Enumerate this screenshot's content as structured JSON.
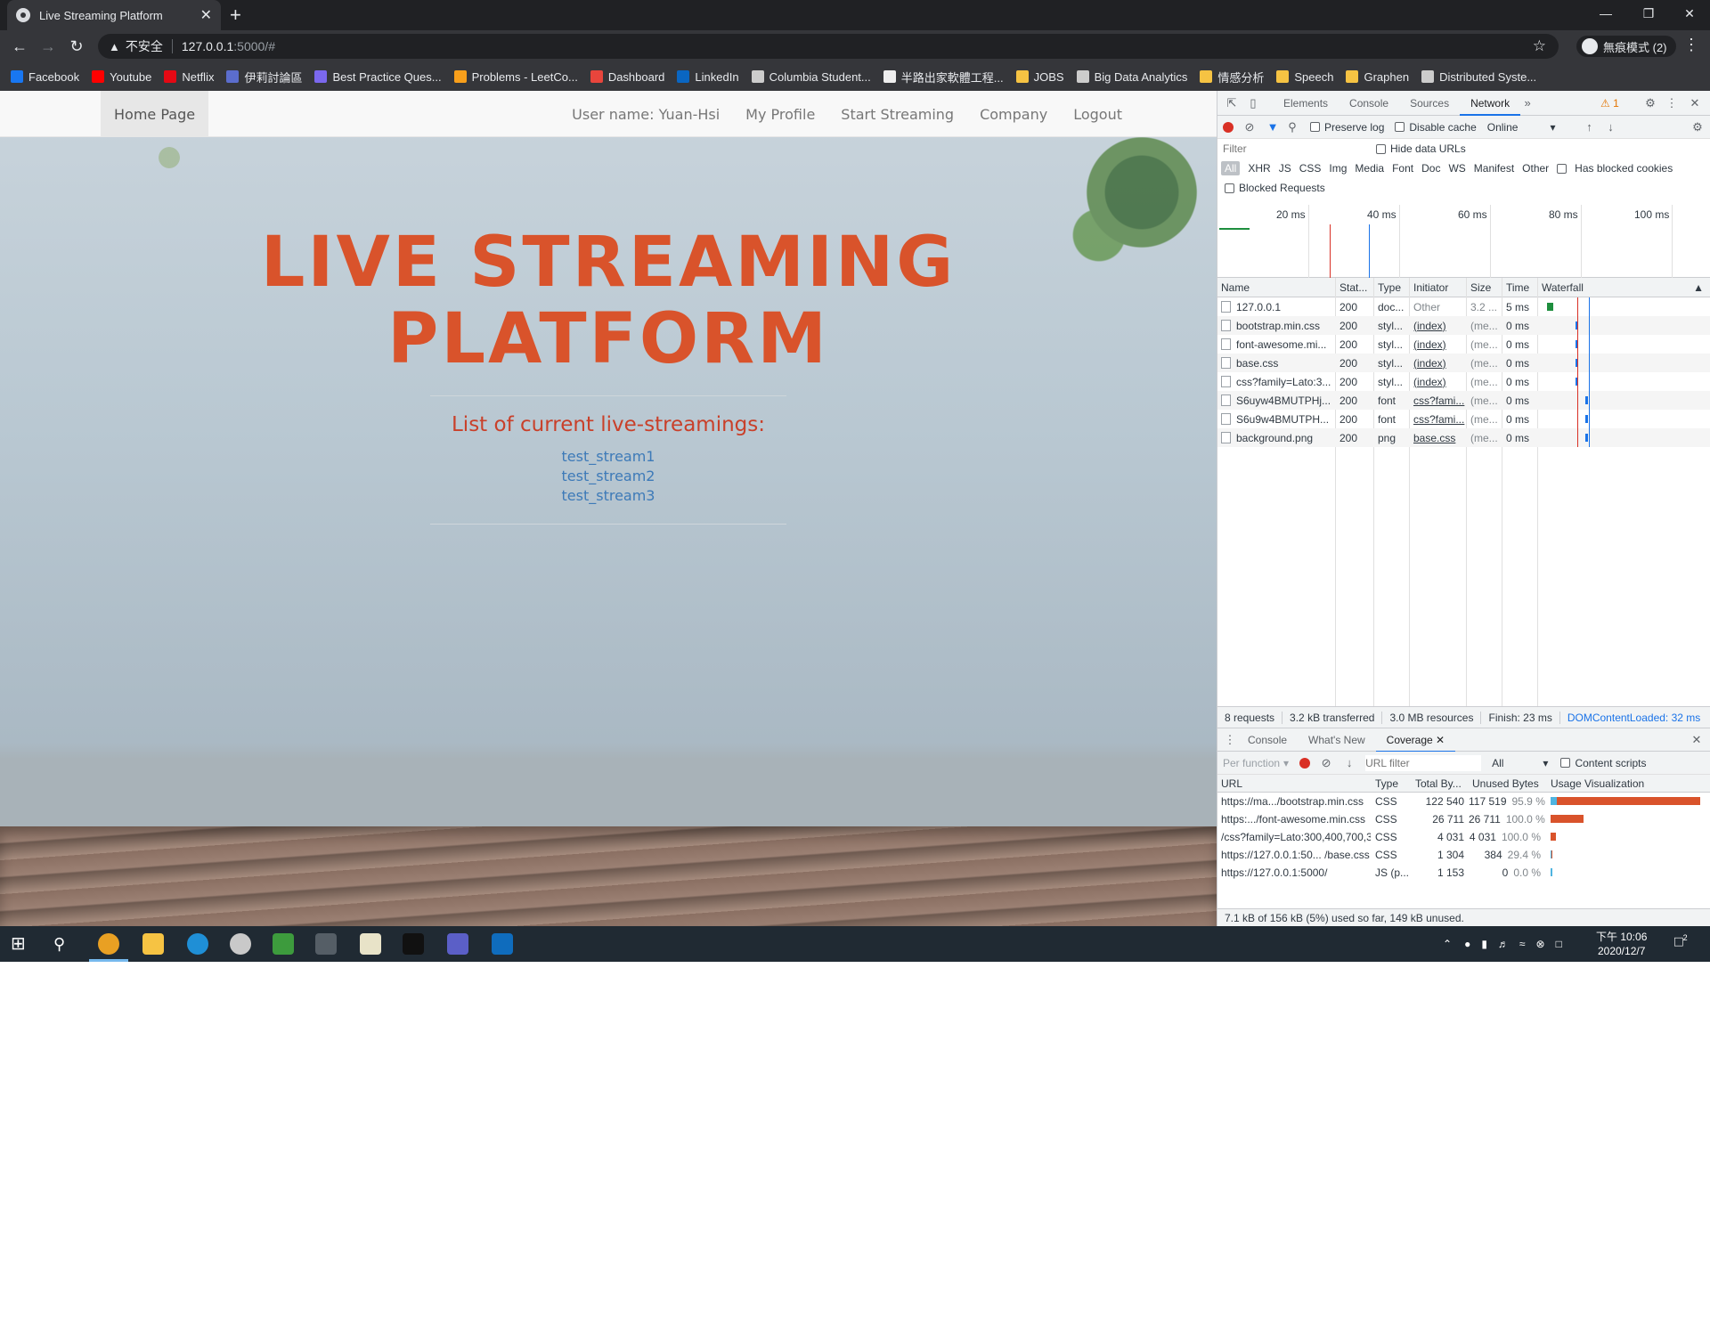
{
  "browser": {
    "tab_title": "Live Streaming Platform",
    "tab_close": "✕",
    "new_tab": "+",
    "url_warning": "不安全",
    "url_host": "127.0.0.1",
    "url_path": ":5000/#",
    "incognito_label": "無痕模式 (2)",
    "bookmarks": [
      {
        "label": "Facebook",
        "color": "#1877f2"
      },
      {
        "label": "Youtube",
        "color": "#ff0000"
      },
      {
        "label": "Netflix",
        "color": "#e50914"
      },
      {
        "label": "伊莉討論區",
        "color": "#5b6dcd"
      },
      {
        "label": "Best Practice Ques...",
        "color": "#7b68ee"
      },
      {
        "label": "Problems - LeetCo...",
        "color": "#f89f1b"
      },
      {
        "label": "Dashboard",
        "color": "#e8453c"
      },
      {
        "label": "LinkedIn",
        "color": "#0a66c2"
      },
      {
        "label": "Columbia Student...",
        "color": "#cccccc"
      },
      {
        "label": "半路出家軟體工程...",
        "color": "#eeeeee"
      },
      {
        "label": "JOBS",
        "color": "#f6c343"
      },
      {
        "label": "Big Data Analytics",
        "color": "#cccccc"
      },
      {
        "label": "情感分析",
        "color": "#f6c343"
      },
      {
        "label": "Speech",
        "color": "#f6c343"
      },
      {
        "label": "Graphen",
        "color": "#f6c343"
      },
      {
        "label": "Distributed Syste...",
        "color": "#cccccc"
      }
    ]
  },
  "page": {
    "nav": {
      "home": "Home Page",
      "username": "User name: Yuan-Hsi",
      "profile": "My Profile",
      "start": "Start Streaming",
      "company": "Company",
      "logout": "Logout"
    },
    "title_line1": "LIVE STREAMING",
    "title_line2": "PLATFORM",
    "subtitle": "List of current live-streamings:",
    "streams": [
      "test_stream1",
      "test_stream2",
      "test_stream3"
    ]
  },
  "devtools": {
    "tabs": [
      "Elements",
      "Console",
      "Sources",
      "Network"
    ],
    "active_tab": "Network",
    "warning_count": "1",
    "preserve_log": "Preserve log",
    "disable_cache": "Disable cache",
    "throttle": "Online",
    "filter_placeholder": "Filter",
    "hide_data_urls": "Hide data URLs",
    "filter_types": [
      "All",
      "XHR",
      "JS",
      "CSS",
      "Img",
      "Media",
      "Font",
      "Doc",
      "WS",
      "Manifest",
      "Other"
    ],
    "has_blocked_cookies": "Has blocked cookies",
    "blocked_requests": "Blocked Requests",
    "timeline_ticks": [
      "20 ms",
      "40 ms",
      "60 ms",
      "80 ms",
      "100 ms"
    ],
    "columns": {
      "name": "Name",
      "status": "Stat...",
      "type": "Type",
      "initiator": "Initiator",
      "size": "Size",
      "time": "Time",
      "waterfall": "Waterfall"
    },
    "requests": [
      {
        "name": "127.0.0.1",
        "status": "200",
        "type": "doc...",
        "initiator": "Other",
        "size": "3.2 ...",
        "time": "5 ms",
        "wf_start": 0.03
      },
      {
        "name": "bootstrap.min.css",
        "status": "200",
        "type": "styl...",
        "initiator": "(index)",
        "size": "(me...",
        "time": "0 ms",
        "wf_start": 0.2
      },
      {
        "name": "font-awesome.mi...",
        "status": "200",
        "type": "styl...",
        "initiator": "(index)",
        "size": "(me...",
        "time": "0 ms",
        "wf_start": 0.2
      },
      {
        "name": "base.css",
        "status": "200",
        "type": "styl...",
        "initiator": "(index)",
        "size": "(me...",
        "time": "0 ms",
        "wf_start": 0.2
      },
      {
        "name": "css?family=Lato:3...",
        "status": "200",
        "type": "styl...",
        "initiator": "(index)",
        "size": "(me...",
        "time": "0 ms",
        "wf_start": 0.2
      },
      {
        "name": "S6uyw4BMUTPHj...",
        "status": "200",
        "type": "font",
        "initiator": "css?fami...",
        "size": "(me...",
        "time": "0 ms",
        "wf_start": 0.26
      },
      {
        "name": "S6u9w4BMUTPH...",
        "status": "200",
        "type": "font",
        "initiator": "css?fami...",
        "size": "(me...",
        "time": "0 ms",
        "wf_start": 0.26
      },
      {
        "name": "background.png",
        "status": "200",
        "type": "png",
        "initiator": "base.css",
        "size": "(me...",
        "time": "0 ms",
        "wf_start": 0.26
      }
    ],
    "summary": [
      "8 requests",
      "3.2 kB transferred",
      "3.0 MB resources",
      "Finish: 23 ms",
      "DOMContentLoaded: 32 ms"
    ],
    "drawer_tabs": [
      "Console",
      "What's New",
      "Coverage"
    ],
    "coverage": {
      "per_function": "Per function",
      "url_filter_placeholder": "URL filter",
      "scope": "All",
      "content_scripts": "Content scripts",
      "columns": {
        "url": "URL",
        "type": "Type",
        "total": "Total By...",
        "unused": "Unused Bytes",
        "viz": "Usage Visualization"
      },
      "rows": [
        {
          "url": "https://ma.../bootstrap.min.css",
          "type": "CSS",
          "total": "122 540",
          "unused": "117 519",
          "pct": "95.9 %",
          "total_frac": 1.0,
          "used_frac": 0.041
        },
        {
          "url": "https:.../font-awesome.min.css",
          "type": "CSS",
          "total": "26 711",
          "unused": "26 711",
          "pct": "100.0 %",
          "total_frac": 0.218,
          "used_frac": 0.0
        },
        {
          "url": "/css?family=Lato:300,400,700,3",
          "type": "CSS",
          "total": "4 031",
          "unused": "4 031",
          "pct": "100.0 %",
          "total_frac": 0.033,
          "used_frac": 0.0
        },
        {
          "url": "https://127.0.0.1:50... /base.css",
          "type": "CSS",
          "total": "1 304",
          "unused": "384",
          "pct": "29.4 %",
          "total_frac": 0.011,
          "used_frac": 0.706
        },
        {
          "url": "https://127.0.0.1:5000/",
          "type": "JS (p...",
          "total": "1 153",
          "unused": "0",
          "pct": "0.0 %",
          "total_frac": 0.009,
          "used_frac": 1.0
        }
      ],
      "footer": "7.1 kB of 156 kB (5%) used so far, 149 kB unused."
    }
  },
  "taskbar": {
    "time": "下午 10:06",
    "date": "2020/12/7",
    "notification_count": "2"
  },
  "colors": {
    "accent": "#d9532b",
    "link": "#3d7ab8",
    "devtools_blue": "#1a73e8"
  }
}
